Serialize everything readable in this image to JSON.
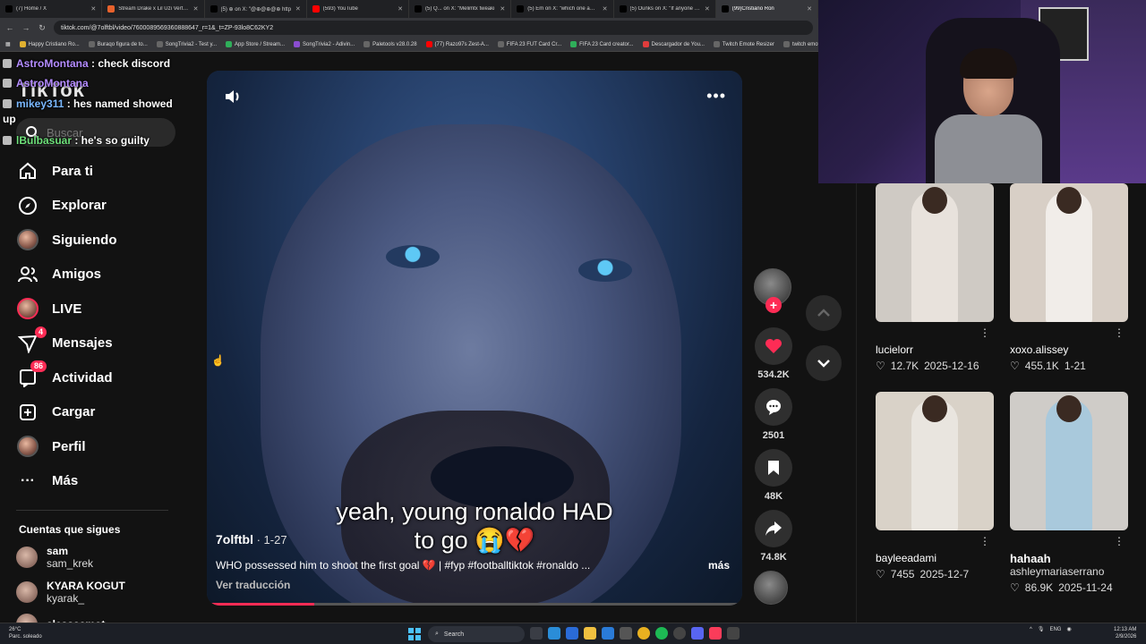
{
  "browser": {
    "tabs": [
      {
        "label": "(7) Home / X",
        "icon": "x-icon",
        "color": "#000000"
      },
      {
        "label": "Stream Drake x Lil Uzi Vert - A",
        "icon": "music-icon",
        "color": "#e8622c"
      },
      {
        "label": "(5) ⊕ on X: \"@⊕@⊕@⊕ http",
        "icon": "x-icon",
        "color": "#000000"
      },
      {
        "label": "(593) YouTube",
        "icon": "youtube-icon",
        "color": "#ff0000"
      },
      {
        "label": "(5) Q... on X: \"Melimtx tweaki",
        "icon": "x-icon",
        "color": "#000000"
      },
      {
        "label": "(5) Em on X: \"which one am i?",
        "icon": "x-icon",
        "color": "#000000"
      },
      {
        "label": "(5) Ounks on X: \"If anyone tell",
        "icon": "x-icon",
        "color": "#000000"
      },
      {
        "label": "(99)Cristiano Ron",
        "icon": "tiktok-icon",
        "color": "#000000"
      }
    ],
    "url": "tiktok.com/@7olftbl/video/7600089569360888647_r=1&_t=ZP-93lo8C62KY2",
    "bookmarks": [
      {
        "label": "Happy Cristiano Ro...",
        "color": "#e0b030"
      },
      {
        "label": "Buraqo figura de to...",
        "color": "#666666"
      },
      {
        "label": "SongTrivia2 - Test y...",
        "color": "#666666"
      },
      {
        "label": "App Store / Stream...",
        "color": "#2fae5a"
      },
      {
        "label": "SongTrivia2 - Adivin...",
        "color": "#8a4dd0"
      },
      {
        "label": "Paletools v28.0.28",
        "color": "#666666"
      },
      {
        "label": "(77) Razo97s Zest-A...",
        "color": "#ff0000"
      },
      {
        "label": "FIFA 23 FUT Card Cr...",
        "color": "#666666"
      },
      {
        "label": "FIFA 23 Card creator...",
        "color": "#2fae5a"
      },
      {
        "label": "Descargador de You...",
        "color": "#e03c3c"
      },
      {
        "label": "Twitch Emote Resizer",
        "color": "#666666"
      },
      {
        "label": "twitch emote r",
        "color": "#666666"
      }
    ]
  },
  "chat": [
    {
      "user": "AstroMontana",
      "msg": " : check discord",
      "color": "#b48cff"
    },
    {
      "user": "AstroMontana",
      "msg": "",
      "color": "#b48cff"
    },
    {
      "user": "mikey311",
      "msg": " : hes named showed",
      "color": "#7ab8ff"
    },
    {
      "user": "",
      "msg": "up",
      "color": "#ffffff"
    },
    {
      "user": "lBulbasuar",
      "msg": " : he's so guilty",
      "color": "#6ee07a"
    }
  ],
  "sidebar": {
    "logo": "TikTok",
    "search_placeholder": "Buscar",
    "nav": [
      {
        "label": "Para ti",
        "icon": "home-icon"
      },
      {
        "label": "Explorar",
        "icon": "compass-icon"
      },
      {
        "label": "Siguiendo",
        "icon": "following-avatar-icon"
      },
      {
        "label": "Amigos",
        "icon": "friends-icon"
      },
      {
        "label": "LIVE",
        "icon": "live-icon"
      },
      {
        "label": "Mensajes",
        "icon": "messages-icon",
        "badge": "4"
      },
      {
        "label": "Actividad",
        "icon": "activity-icon",
        "badge": "86"
      },
      {
        "label": "Cargar",
        "icon": "upload-icon"
      },
      {
        "label": "Perfil",
        "icon": "profile-avatar-icon"
      },
      {
        "label": "Más",
        "icon": "more-icon"
      }
    ],
    "following_title": "Cuentas que sigues",
    "following": [
      {
        "name": "sam",
        "handle": "sam_krek"
      },
      {
        "name": "KYARA KOGUT",
        "handle": "kyarak_"
      },
      {
        "name": "alessaamot",
        "handle": ""
      }
    ]
  },
  "video": {
    "subtitle_line1": "yeah, young ronaldo HAD",
    "subtitle_line2": "to go 😭💔",
    "author": "7olftbl",
    "date": " · 1-27",
    "description": "WHO possessed him to shoot the first goal 💔 | #fyp #footballtiktok #ronaldo ...",
    "more": "más",
    "translate": "Ver traducción",
    "progress": 0.2
  },
  "actions": {
    "likes": "534.2K",
    "comments": "2501",
    "saves": "48K",
    "shares": "74.8K"
  },
  "grid": [
    {
      "user": "lucielorr",
      "likes": "12.7K",
      "date": "2025-12-16",
      "bg": "#cfcac4",
      "fig": "#e8e2dc"
    },
    {
      "user": "xoxo.alissey",
      "likes": "455.1K",
      "date": "1-21",
      "bg": "#d8cfc6",
      "fig": "#f1ede9"
    },
    {
      "user": "bayleeadami",
      "likes": "7455",
      "date": "2025-12-7",
      "bg": "#d9d2c8",
      "fig": "#e9e5df"
    },
    {
      "user": "hahaah",
      "likes": "86.9K",
      "date": "2025-11-24",
      "bg": "#cfccc8",
      "fig": "#a9c9dc",
      "handle": "ashleymariaserrano"
    }
  ],
  "taskbar": {
    "weather_temp": "26°C",
    "weather_desc": "Parc. soleado",
    "search_label": "Search",
    "lang": "ENG",
    "time": "12:13 AM",
    "date": "2/9/2026"
  }
}
